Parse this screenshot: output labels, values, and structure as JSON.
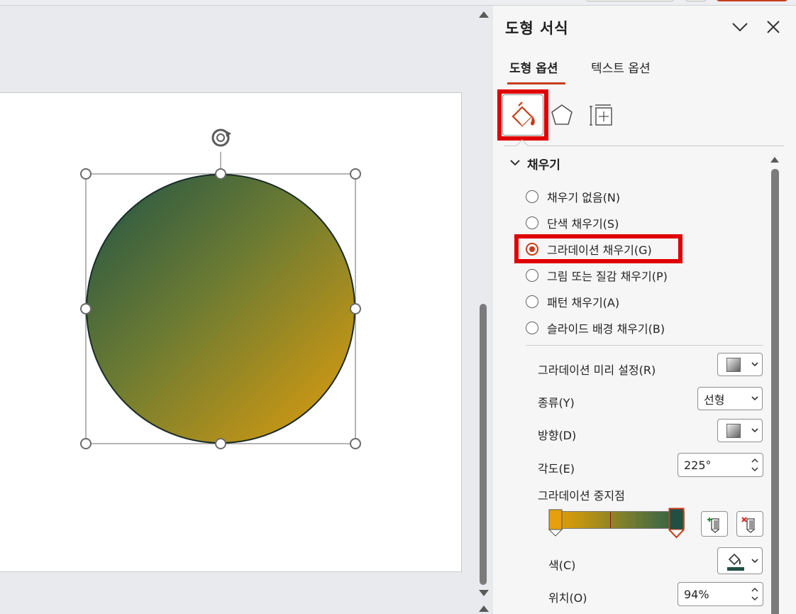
{
  "pane": {
    "title": "도형 서식",
    "tabs": [
      {
        "label": "도형 옵션",
        "active": true
      },
      {
        "label": "텍스트 옵션",
        "active": false
      }
    ]
  },
  "fill_section": {
    "title": "채우기",
    "options": [
      {
        "label": "채우기 없음(N)",
        "checked": false
      },
      {
        "label": "단색 채우기(S)",
        "checked": false
      },
      {
        "label": "그라데이션 채우기(G)",
        "checked": true
      },
      {
        "label": "그림 또는 질감 채우기(P)",
        "checked": false
      },
      {
        "label": "패턴 채우기(A)",
        "checked": false
      },
      {
        "label": "슬라이드 배경 채우기(B)",
        "checked": false
      }
    ]
  },
  "gradient": {
    "preset_label": "그라데이션 미리 설정(R)",
    "type_label": "종류(Y)",
    "type_value": "선형",
    "direction_label": "방향(D)",
    "angle_label": "각도(E)",
    "angle_value": "225°",
    "stops_label": "그라데이션 중지점",
    "color_label": "색(C)",
    "position_label": "위치(O)",
    "position_value": "94%"
  },
  "colors": {
    "accent": "#c43e1c",
    "highlight": "#e00000",
    "shape_gradient_start": "#2e5a4a",
    "shape_gradient_end": "#d89a10"
  }
}
